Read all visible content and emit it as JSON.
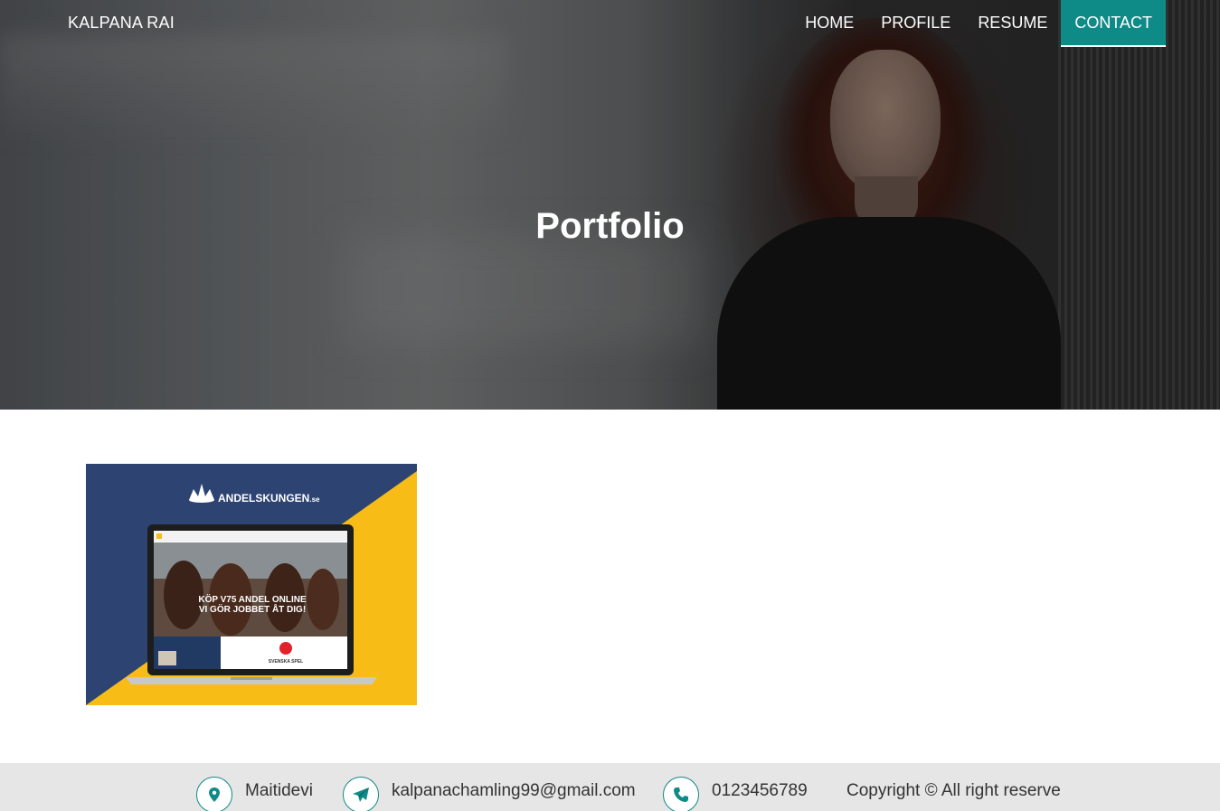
{
  "header": {
    "brand": "KALPANA RAI",
    "nav": [
      {
        "label": "HOME",
        "active": false
      },
      {
        "label": "PROFILE",
        "active": false
      },
      {
        "label": "RESUME",
        "active": false
      },
      {
        "label": "CONTACT",
        "active": true
      }
    ]
  },
  "hero": {
    "title": "Portfolio"
  },
  "portfolio": {
    "items": [
      {
        "brand_text": "ANDELSKUNGEN",
        "brand_suffix": ".se",
        "headline_line1": "KÖP V75 ANDEL ONLINE",
        "headline_line2": "VI GÖR JOBBET ÅT DIG!",
        "partner": "SVENSKA SPEL"
      }
    ]
  },
  "footer": {
    "address": "Maitidevi",
    "email": "kalpanachamling99@gmail.com",
    "phone": "0123456789",
    "copyright": "Copyright © All right reserve"
  },
  "colors": {
    "accent": "#0f8b87",
    "footer_bg": "#e6e6e6",
    "thumb_navy": "#2d4472",
    "thumb_yellow": "#f7bd16"
  },
  "icons": {
    "address": "map-marker-icon",
    "email": "paper-plane-icon",
    "phone": "phone-icon"
  }
}
